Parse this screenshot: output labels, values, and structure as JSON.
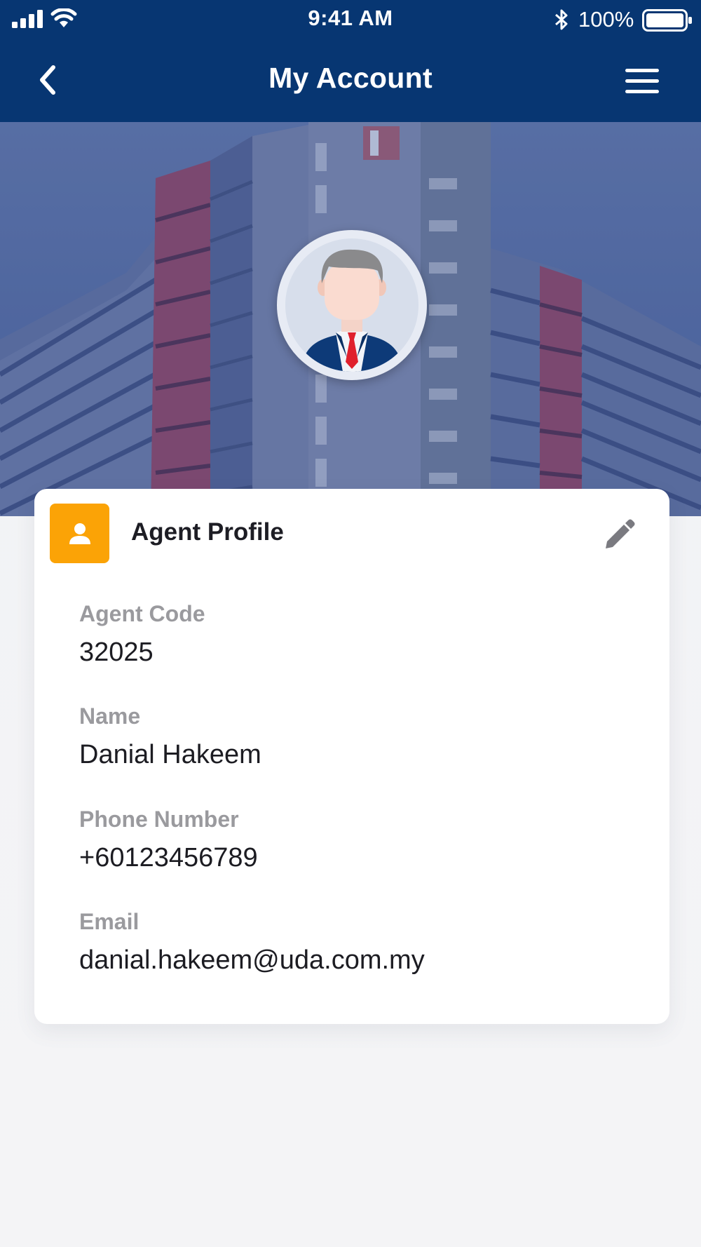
{
  "status_bar": {
    "time": "9:41 AM",
    "battery": "100%",
    "icons": [
      "signal-icon",
      "wifi-icon",
      "bluetooth-icon",
      "battery-icon"
    ]
  },
  "nav": {
    "title": "My Account",
    "back_icon": "chevron-left-icon",
    "menu_icon": "hamburger-menu-icon"
  },
  "colors": {
    "nav_background": "#073672",
    "badge": "#fba306",
    "tie": "#e0202c",
    "suit": "#0d3a78"
  },
  "profile": {
    "section_title": "Agent Profile",
    "badge_icon": "person-icon",
    "edit_icon": "pencil-icon",
    "fields": [
      {
        "label": "Agent Code",
        "value": "32025"
      },
      {
        "label": "Name",
        "value": "Danial Hakeem"
      },
      {
        "label": "Phone Number",
        "value": "+60123456789"
      },
      {
        "label": "Email",
        "value": "danial.hakeem@uda.com.my"
      }
    ]
  }
}
